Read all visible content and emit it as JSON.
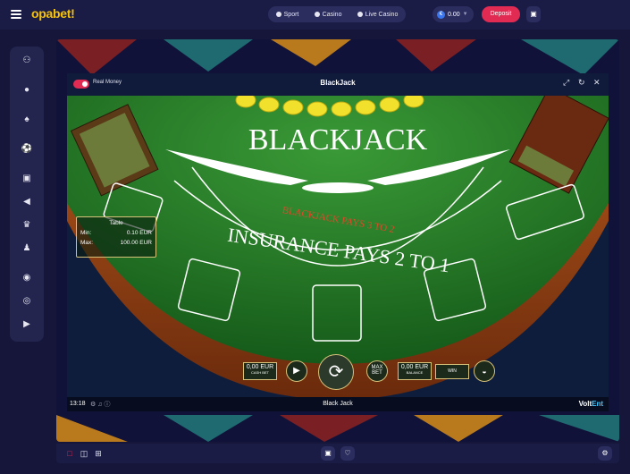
{
  "header": {
    "logo": "opabet!",
    "nav": [
      {
        "label": "Sport",
        "icon": "soccer-ball-icon"
      },
      {
        "label": "Casino",
        "icon": "casino-chip-icon"
      },
      {
        "label": "Live Casino",
        "icon": "live-icon"
      }
    ],
    "balance": {
      "currency_symbol": "€",
      "amount": "0.00"
    },
    "deposit_label": "Deposit",
    "gift_icon": "gift-icon"
  },
  "sidebar": {
    "items": [
      {
        "icon": "user-icon",
        "glyph": "⚇"
      },
      {
        "icon": "coin-icon",
        "glyph": "●"
      },
      {
        "icon": "cards-icon",
        "glyph": "♠"
      },
      {
        "icon": "ball-icon",
        "glyph": "⚽"
      },
      {
        "icon": "gift-icon",
        "glyph": "▣"
      },
      {
        "icon": "megaphone-icon",
        "glyph": "◀"
      },
      {
        "icon": "trophy-icon",
        "glyph": "♛"
      },
      {
        "icon": "person-icon",
        "glyph": "♟"
      },
      {
        "icon": "support-icon",
        "glyph": "◉"
      },
      {
        "icon": "globe-icon",
        "glyph": "◎"
      },
      {
        "icon": "logout-icon",
        "glyph": "▶"
      }
    ]
  },
  "game": {
    "mode_label": "Real Money",
    "title": "BlackJack",
    "table_logo": "BLACKJACK",
    "pays_text": "BLACKJACK PAYS 3 TO 2",
    "insurance_text": "INSURANCE PAYS 2 TO 1",
    "limits": {
      "header": "Table",
      "min_label": "Min:",
      "min_value": "0.10 EUR",
      "max_label": "Max:",
      "max_value": "100.00 EUR"
    },
    "controls": {
      "cash_bet_value": "0,00 EUR",
      "cash_bet_label": "CASH BET",
      "max_bet_line1": "MAX",
      "max_bet_line2": "BET",
      "balance_value": "0,00 EUR",
      "balance_label": "BALANCE",
      "win_label": "WIN"
    },
    "footer": {
      "time": "13:18",
      "game_name": "Black Jack",
      "brand_left": "Volt",
      "brand_right": "Ent"
    }
  },
  "bottom": {
    "left_icons": [
      "window-icon",
      "split-icon",
      "grid-icon"
    ],
    "center_icons": [
      "gift-icon",
      "heart-icon"
    ],
    "right_icon": "settings-icon"
  },
  "colors": {
    "accent_red": "#e12b53",
    "felt_green": "#2a7d2b",
    "gold": "#f4c20d",
    "panel": "#23254f"
  }
}
